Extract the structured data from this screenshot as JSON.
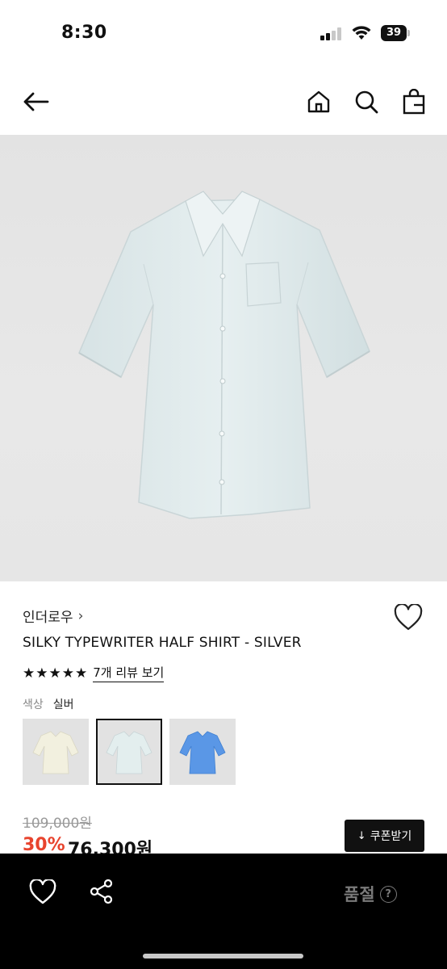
{
  "status_bar": {
    "time": "8:30",
    "battery_level": "39",
    "icons": [
      "signal-icon",
      "wifi-icon",
      "battery-icon"
    ]
  },
  "nav": {
    "icons": [
      "back-arrow-icon",
      "home-icon",
      "search-icon",
      "shopping-bag-icon"
    ]
  },
  "product": {
    "image_icon": "shirt-photo",
    "brand": "인더로우",
    "brand_chevron": "›",
    "title": "SILKY TYPEWRITER HALF SHIRT - SILVER",
    "rating_stars": 5,
    "stars": [
      "★",
      "★",
      "★",
      "★",
      "★"
    ],
    "review_link": "7개 리뷰 보기",
    "color_label": "색상",
    "color_value": "실버",
    "swatches": [
      {
        "color": "#f2f0df"
      },
      {
        "color": "#e3eeee",
        "selected": true
      },
      {
        "color": "#5a97e6"
      }
    ],
    "original_price": "109,000원",
    "discount": "30%",
    "sale_price": "76,300원",
    "coupon_label": "쿠폰받기",
    "coupon_icon": "↓"
  },
  "bottom_bar": {
    "icons": [
      "heart-icon",
      "share-icon",
      "help-icon"
    ],
    "status": "품절",
    "help_glyph": "?"
  },
  "colors": {
    "discount": "#e8442e",
    "bottom_bar_bg": "#000000",
    "soldout_text": "#7a7a7a"
  }
}
